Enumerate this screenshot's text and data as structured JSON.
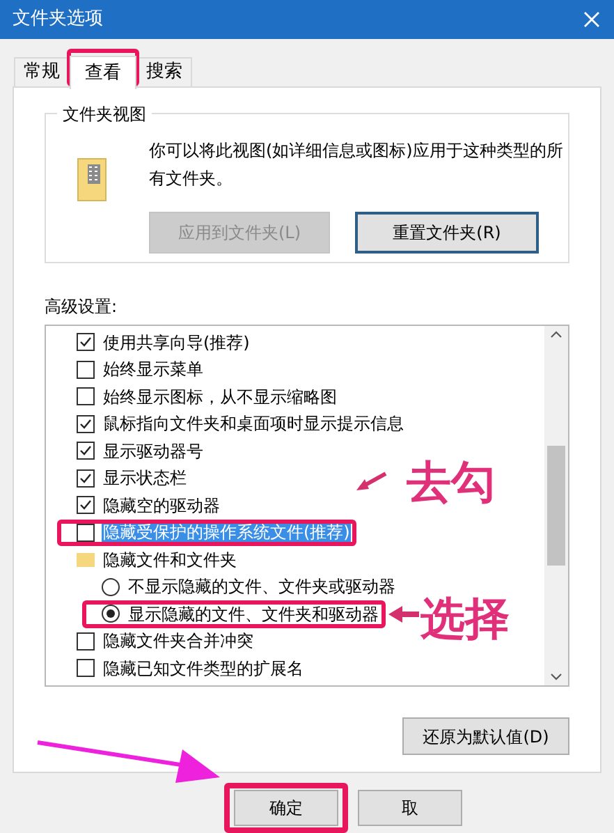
{
  "window": {
    "title": "文件夹选项"
  },
  "tabs": [
    {
      "label": "常规",
      "selected": false
    },
    {
      "label": "查看",
      "selected": true
    },
    {
      "label": "搜索",
      "selected": false
    }
  ],
  "folder_view": {
    "title": "文件夹视图",
    "description": "你可以将此视图(如详细信息或图标)应用于这种类型的所有文件夹。",
    "buttons": [
      {
        "label": "应用到文件夹(L)",
        "disabled": true
      },
      {
        "label": "重置文件夹(R)",
        "disabled": false
      }
    ]
  },
  "advanced": {
    "label": "高级设置:",
    "items": [
      {
        "kind": "checkbox",
        "label": "使用共享向导(推荐)",
        "checked": true,
        "selected": false
      },
      {
        "kind": "checkbox",
        "label": "始终显示菜单",
        "checked": false,
        "selected": false
      },
      {
        "kind": "checkbox",
        "label": "始终显示图标，从不显示缩略图",
        "checked": false,
        "selected": false
      },
      {
        "kind": "checkbox",
        "label": "鼠标指向文件夹和桌面项时显示提示信息",
        "checked": true,
        "selected": false
      },
      {
        "kind": "checkbox",
        "label": "显示驱动器号",
        "checked": true,
        "selected": false
      },
      {
        "kind": "checkbox",
        "label": "显示状态栏",
        "checked": true,
        "selected": false
      },
      {
        "kind": "checkbox",
        "label": "隐藏空的驱动器",
        "checked": true,
        "selected": false
      },
      {
        "kind": "checkbox",
        "label": "隐藏受保护的操作系统文件(推荐)",
        "checked": false,
        "selected": true
      },
      {
        "kind": "folder",
        "label": "隐藏文件和文件夹",
        "selected": false
      },
      {
        "kind": "radio",
        "label": "不显示隐藏的文件、文件夹或驱动器",
        "checked": false,
        "selected": false
      },
      {
        "kind": "radio",
        "label": "显示隐藏的文件、文件夹和驱动器",
        "checked": true,
        "selected": false
      },
      {
        "kind": "checkbox",
        "label": "隐藏文件夹合并冲突",
        "checked": false,
        "selected": false
      },
      {
        "kind": "checkbox",
        "label": "隐藏已知文件类型的扩展名",
        "checked": false,
        "selected": false
      }
    ]
  },
  "restore_button": "还原为默认值(D)",
  "buttons": [
    "确定",
    "取"
  ],
  "annotations": [
    {
      "kind": "label",
      "text": "去勾"
    },
    {
      "kind": "label",
      "text": "选择"
    }
  ]
}
